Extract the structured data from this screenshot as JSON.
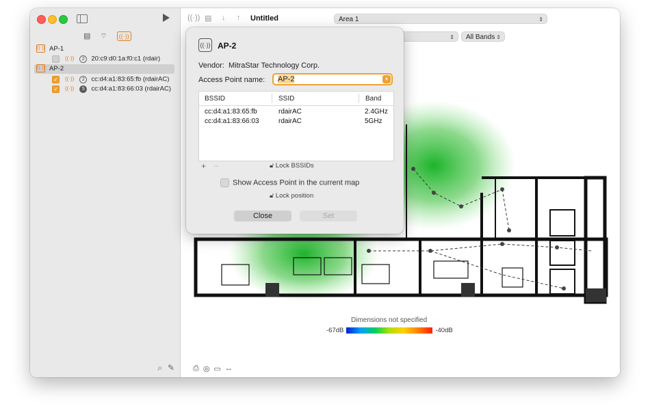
{
  "window": {
    "toolbar": {
      "doc_title": "Untitled",
      "area_select": "Area 1",
      "band_select": "All Bands"
    },
    "sidebar": {
      "tree": [
        {
          "label": "AP-1",
          "type": "ap",
          "selected": false
        },
        {
          "label": "20:c9:d0:1a:f0:c1 (rdair)",
          "type": "bssid",
          "checked": false,
          "channel": "2"
        },
        {
          "label": "AP-2",
          "type": "ap",
          "selected": true
        },
        {
          "label": "cc:d4:a1:83:65:fb (rdairAC)",
          "type": "bssid",
          "checked": true,
          "channel": "2"
        },
        {
          "label": "cc:d4:a1:83:66:03 (rdairAC)",
          "type": "bssid",
          "checked": true,
          "channel": "5"
        }
      ]
    },
    "map": {
      "dimensions_text": "Dimensions not specified",
      "legend_min": "-67dB",
      "legend_max": "-40dB"
    }
  },
  "popover": {
    "title": "AP-2",
    "vendor_label": "Vendor:",
    "vendor_value": "MitraStar Technology Corp.",
    "name_label": "Access Point name:",
    "name_value": "AP-2",
    "table": {
      "headers": [
        "BSSID",
        "SSID",
        "Band"
      ],
      "rows": [
        [
          "cc:d4:a1:83:65:fb",
          "rdairAC",
          "2.4GHz"
        ],
        [
          "cc:d4:a1:83:66:03",
          "rdairAC",
          "5GHz"
        ]
      ]
    },
    "add_label": "+",
    "remove_label": "−",
    "lock_bssids_label": "Lock BSSIDs",
    "show_in_map_label": "Show Access Point in the current map",
    "lock_position_label": "Lock position",
    "close_label": "Close",
    "set_label": "Set"
  },
  "colors": {
    "accent": "#f0a030",
    "heat_green": "#22c034"
  }
}
